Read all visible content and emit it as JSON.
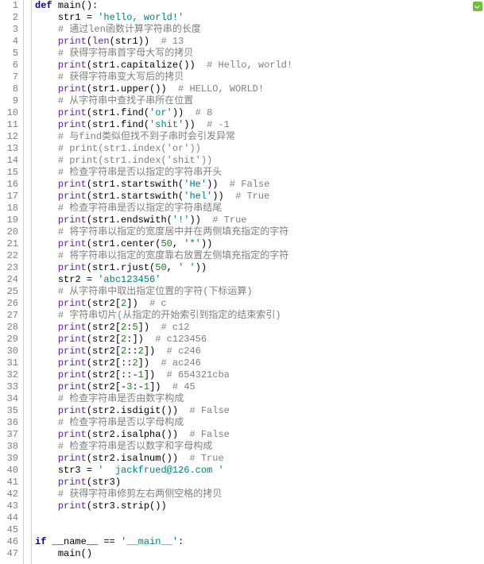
{
  "meta": {
    "line_count": 47
  },
  "code": [
    {
      "n": 1,
      "i": 0,
      "tokens": [
        [
          "kw",
          "def"
        ],
        [
          "op",
          " "
        ],
        [
          "fn",
          "main"
        ],
        [
          "op",
          "():"
        ]
      ]
    },
    {
      "n": 2,
      "i": 1,
      "tokens": [
        [
          "op",
          "str1 = "
        ],
        [
          "str",
          "'hello, world!'"
        ]
      ]
    },
    {
      "n": 3,
      "i": 1,
      "tokens": [
        [
          "cmt",
          "# 通过len函数计算字符串的长度"
        ]
      ]
    },
    {
      "n": 4,
      "i": 1,
      "tokens": [
        [
          "bi",
          "print"
        ],
        [
          "op",
          "("
        ],
        [
          "bi",
          "len"
        ],
        [
          "op",
          "(str1))  "
        ],
        [
          "cmt",
          "# 13"
        ]
      ]
    },
    {
      "n": 5,
      "i": 1,
      "tokens": [
        [
          "cmt",
          "# 获得字符串首字母大写的拷贝"
        ]
      ]
    },
    {
      "n": 6,
      "i": 1,
      "tokens": [
        [
          "bi",
          "print"
        ],
        [
          "op",
          "(str1.capitalize())  "
        ],
        [
          "cmt",
          "# Hello, world!"
        ]
      ]
    },
    {
      "n": 7,
      "i": 1,
      "tokens": [
        [
          "cmt",
          "# 获得字符串变大写后的拷贝"
        ]
      ]
    },
    {
      "n": 8,
      "i": 1,
      "tokens": [
        [
          "bi",
          "print"
        ],
        [
          "op",
          "(str1.upper())  "
        ],
        [
          "cmt",
          "# HELLO, WORLD!"
        ]
      ]
    },
    {
      "n": 9,
      "i": 1,
      "tokens": [
        [
          "cmt",
          "# 从字符串中查找子串所在位置"
        ]
      ]
    },
    {
      "n": 10,
      "i": 1,
      "tokens": [
        [
          "bi",
          "print"
        ],
        [
          "op",
          "(str1.find("
        ],
        [
          "str",
          "'or'"
        ],
        [
          "op",
          "))  "
        ],
        [
          "cmt",
          "# 8"
        ]
      ]
    },
    {
      "n": 11,
      "i": 1,
      "tokens": [
        [
          "bi",
          "print"
        ],
        [
          "op",
          "(str1.find("
        ],
        [
          "str",
          "'shit'"
        ],
        [
          "op",
          "))  "
        ],
        [
          "cmt",
          "# -1"
        ]
      ]
    },
    {
      "n": 12,
      "i": 1,
      "tokens": [
        [
          "cmt",
          "# 与find类似但找不到子串时会引发异常"
        ]
      ]
    },
    {
      "n": 13,
      "i": 1,
      "tokens": [
        [
          "cmt",
          "# print(str1.index('or'))"
        ]
      ]
    },
    {
      "n": 14,
      "i": 1,
      "tokens": [
        [
          "cmt",
          "# print(str1.index('shit'))"
        ]
      ]
    },
    {
      "n": 15,
      "i": 1,
      "tokens": [
        [
          "cmt",
          "# 检查字符串是否以指定的字符串开头"
        ]
      ]
    },
    {
      "n": 16,
      "i": 1,
      "tokens": [
        [
          "bi",
          "print"
        ],
        [
          "op",
          "(str1.startswith("
        ],
        [
          "str",
          "'He'"
        ],
        [
          "op",
          "))  "
        ],
        [
          "cmt",
          "# False"
        ]
      ]
    },
    {
      "n": 17,
      "i": 1,
      "tokens": [
        [
          "bi",
          "print"
        ],
        [
          "op",
          "(str1.startswith("
        ],
        [
          "str",
          "'hel'"
        ],
        [
          "op",
          "))  "
        ],
        [
          "cmt",
          "# True"
        ]
      ]
    },
    {
      "n": 18,
      "i": 1,
      "tokens": [
        [
          "cmt",
          "# 检查字符串是否以指定的字符串结尾"
        ]
      ]
    },
    {
      "n": 19,
      "i": 1,
      "tokens": [
        [
          "bi",
          "print"
        ],
        [
          "op",
          "(str1.endswith("
        ],
        [
          "str",
          "'!'"
        ],
        [
          "op",
          "))  "
        ],
        [
          "cmt",
          "# True"
        ]
      ]
    },
    {
      "n": 20,
      "i": 1,
      "tokens": [
        [
          "cmt",
          "# 将字符串以指定的宽度居中并在两侧填充指定的字符"
        ]
      ]
    },
    {
      "n": 21,
      "i": 1,
      "tokens": [
        [
          "bi",
          "print"
        ],
        [
          "op",
          "(str1.center("
        ],
        [
          "num",
          "50"
        ],
        [
          "op",
          ", "
        ],
        [
          "str",
          "'*'"
        ],
        [
          "op",
          "))"
        ]
      ]
    },
    {
      "n": 22,
      "i": 1,
      "tokens": [
        [
          "cmt",
          "# 将字符串以指定的宽度靠右放置左侧填充指定的字符"
        ]
      ]
    },
    {
      "n": 23,
      "i": 1,
      "tokens": [
        [
          "bi",
          "print"
        ],
        [
          "op",
          "(str1.rjust("
        ],
        [
          "num",
          "50"
        ],
        [
          "op",
          ", "
        ],
        [
          "str",
          "' '"
        ],
        [
          "op",
          "))"
        ]
      ]
    },
    {
      "n": 24,
      "i": 1,
      "tokens": [
        [
          "op",
          "str2 = "
        ],
        [
          "str",
          "'abc123456'"
        ]
      ]
    },
    {
      "n": 25,
      "i": 1,
      "tokens": [
        [
          "cmt",
          "# 从字符串中取出指定位置的字符(下标运算)"
        ]
      ]
    },
    {
      "n": 26,
      "i": 1,
      "tokens": [
        [
          "bi",
          "print"
        ],
        [
          "op",
          "(str2["
        ],
        [
          "num",
          "2"
        ],
        [
          "op",
          "])  "
        ],
        [
          "cmt",
          "# c"
        ]
      ]
    },
    {
      "n": 27,
      "i": 1,
      "tokens": [
        [
          "cmt",
          "# 字符串切片(从指定的开始索引到指定的结束索引)"
        ]
      ]
    },
    {
      "n": 28,
      "i": 1,
      "tokens": [
        [
          "bi",
          "print"
        ],
        [
          "op",
          "(str2["
        ],
        [
          "num",
          "2"
        ],
        [
          "op",
          ":"
        ],
        [
          "num",
          "5"
        ],
        [
          "op",
          "])  "
        ],
        [
          "cmt",
          "# c12"
        ]
      ]
    },
    {
      "n": 29,
      "i": 1,
      "tokens": [
        [
          "bi",
          "print"
        ],
        [
          "op",
          "(str2["
        ],
        [
          "num",
          "2"
        ],
        [
          "op",
          ":])  "
        ],
        [
          "cmt",
          "# c123456"
        ]
      ]
    },
    {
      "n": 30,
      "i": 1,
      "tokens": [
        [
          "bi",
          "print"
        ],
        [
          "op",
          "(str2["
        ],
        [
          "num",
          "2"
        ],
        [
          "op",
          "::"
        ],
        [
          "num",
          "2"
        ],
        [
          "op",
          "])  "
        ],
        [
          "cmt",
          "# c246"
        ]
      ]
    },
    {
      "n": 31,
      "i": 1,
      "tokens": [
        [
          "bi",
          "print"
        ],
        [
          "op",
          "(str2[::"
        ],
        [
          "num",
          "2"
        ],
        [
          "op",
          "])  "
        ],
        [
          "cmt",
          "# ac246"
        ]
      ]
    },
    {
      "n": 32,
      "i": 1,
      "tokens": [
        [
          "bi",
          "print"
        ],
        [
          "op",
          "(str2[::-"
        ],
        [
          "num",
          "1"
        ],
        [
          "op",
          "])  "
        ],
        [
          "cmt",
          "# 654321cba"
        ]
      ]
    },
    {
      "n": 33,
      "i": 1,
      "tokens": [
        [
          "bi",
          "print"
        ],
        [
          "op",
          "(str2[-"
        ],
        [
          "num",
          "3"
        ],
        [
          "op",
          ":-"
        ],
        [
          "num",
          "1"
        ],
        [
          "op",
          "])  "
        ],
        [
          "cmt",
          "# 45"
        ]
      ]
    },
    {
      "n": 34,
      "i": 1,
      "tokens": [
        [
          "cmt",
          "# 检查字符串是否由数字构成"
        ]
      ]
    },
    {
      "n": 35,
      "i": 1,
      "tokens": [
        [
          "bi",
          "print"
        ],
        [
          "op",
          "(str2.isdigit())  "
        ],
        [
          "cmt",
          "# False"
        ]
      ]
    },
    {
      "n": 36,
      "i": 1,
      "tokens": [
        [
          "cmt",
          "# 检查字符串是否以字母构成"
        ]
      ]
    },
    {
      "n": 37,
      "i": 1,
      "tokens": [
        [
          "bi",
          "print"
        ],
        [
          "op",
          "(str2.isalpha())  "
        ],
        [
          "cmt",
          "# False"
        ]
      ]
    },
    {
      "n": 38,
      "i": 1,
      "tokens": [
        [
          "cmt",
          "# 检查字符串是否以数字和字母构成"
        ]
      ]
    },
    {
      "n": 39,
      "i": 1,
      "tokens": [
        [
          "bi",
          "print"
        ],
        [
          "op",
          "(str2.isalnum())  "
        ],
        [
          "cmt",
          "# True"
        ]
      ]
    },
    {
      "n": 40,
      "i": 1,
      "tokens": [
        [
          "op",
          "str3 = "
        ],
        [
          "str",
          "'  jackfrued@126.com '"
        ]
      ]
    },
    {
      "n": 41,
      "i": 1,
      "tokens": [
        [
          "bi",
          "print"
        ],
        [
          "op",
          "(str3)"
        ]
      ]
    },
    {
      "n": 42,
      "i": 1,
      "tokens": [
        [
          "cmt",
          "# 获得字符串修剪左右两侧空格的拷贝"
        ]
      ]
    },
    {
      "n": 43,
      "i": 1,
      "tokens": [
        [
          "bi",
          "print"
        ],
        [
          "op",
          "(str3.strip())"
        ]
      ]
    },
    {
      "n": 44,
      "i": 0,
      "tokens": []
    },
    {
      "n": 45,
      "i": 0,
      "tokens": []
    },
    {
      "n": 46,
      "i": 0,
      "tokens": [
        [
          "kw",
          "if"
        ],
        [
          "op",
          " __name__ == "
        ],
        [
          "str",
          "'__main__'"
        ],
        [
          "op",
          ":"
        ]
      ]
    },
    {
      "n": 47,
      "i": 1,
      "tokens": [
        [
          "fn",
          "main"
        ],
        [
          "op",
          "()"
        ]
      ]
    }
  ]
}
